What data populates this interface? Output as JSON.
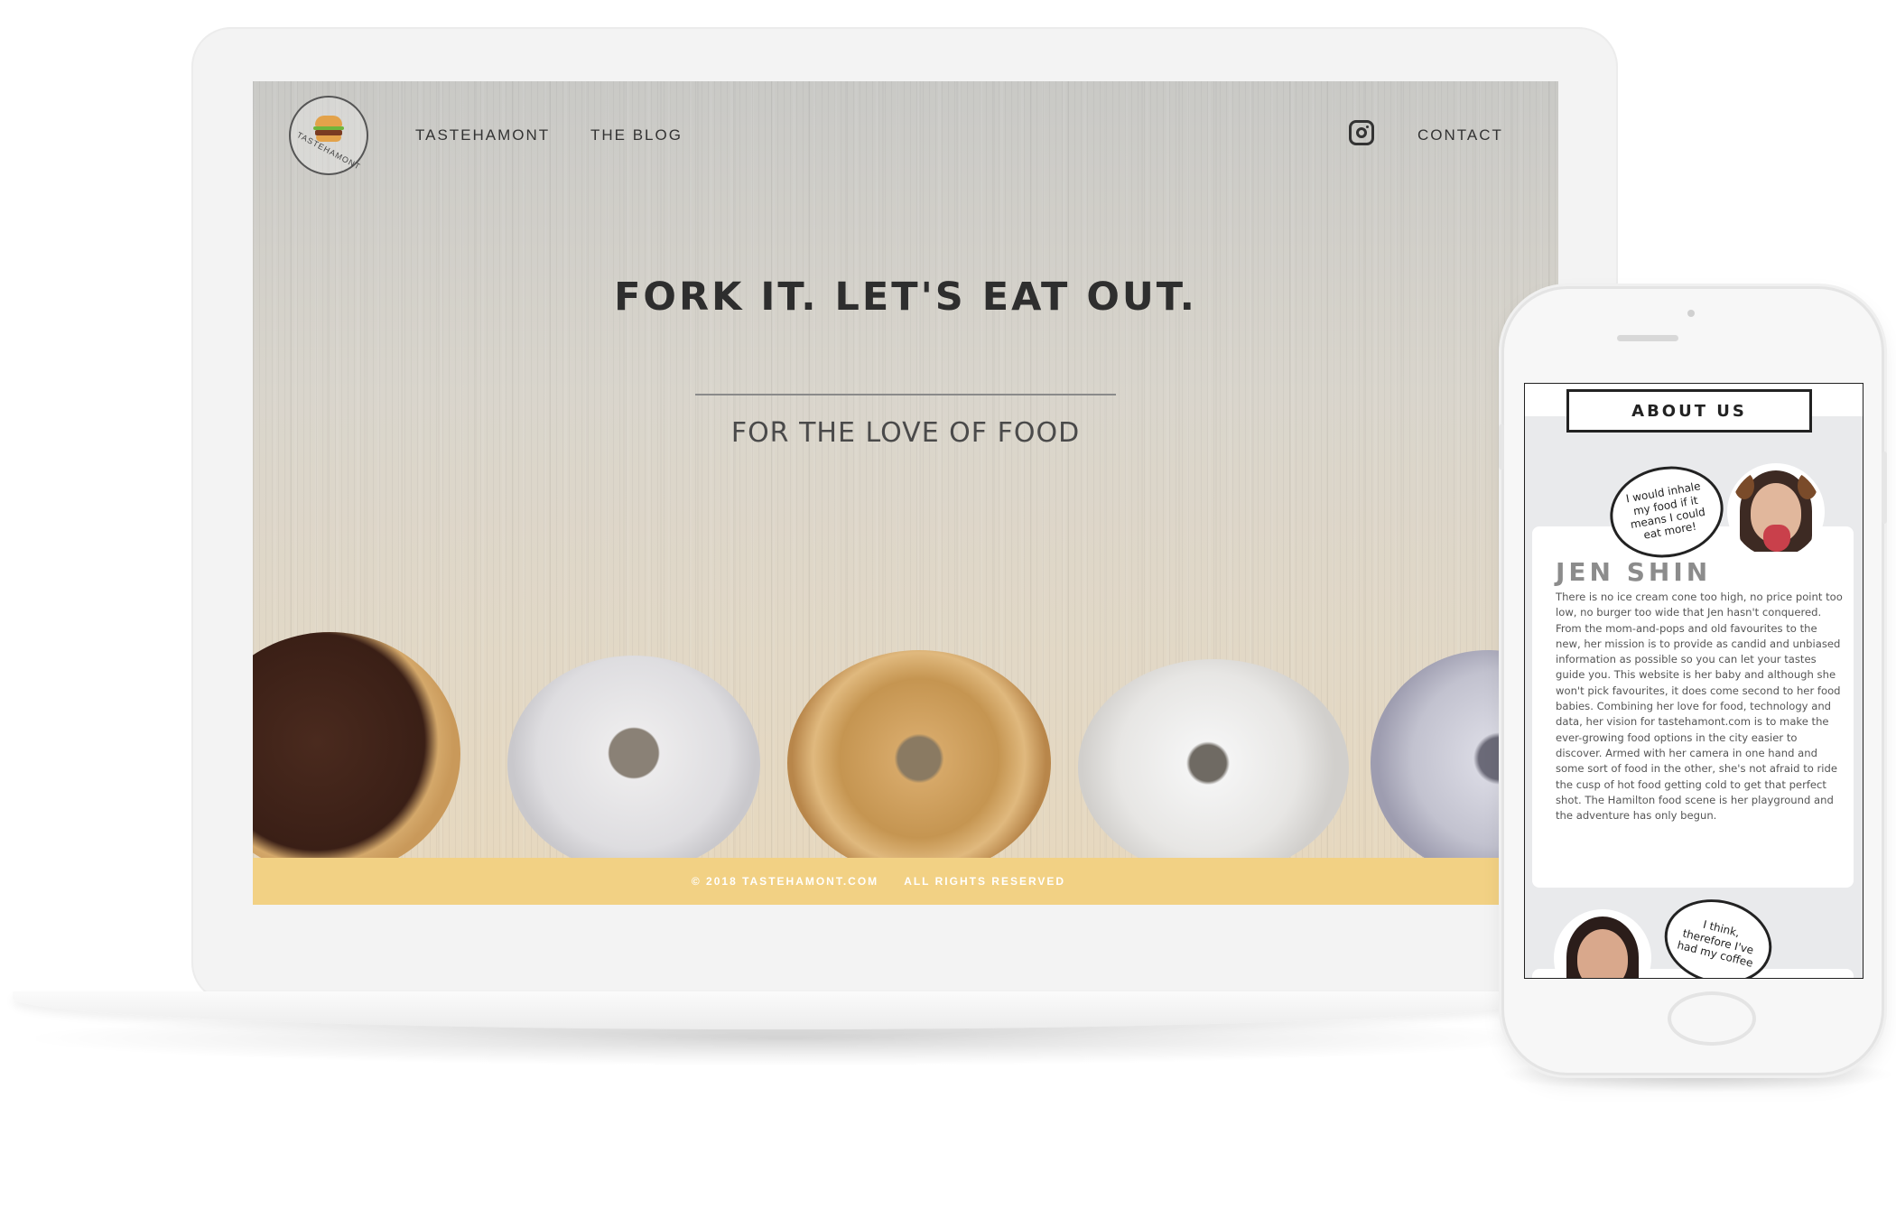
{
  "site": {
    "logo_text": "TASTEHAMONT",
    "nav": {
      "brand": "TASTEHAMONT",
      "blog": "THE BLOG",
      "contact": "CONTACT"
    },
    "hero": {
      "title": "FORK IT. LET'S EAT OUT.",
      "subtitle": "FOR THE LOVE OF FOOD"
    },
    "footer": {
      "copyright": "© 2018 TASTEHAMONT.COM",
      "rights": "ALL RIGHTS RESERVED"
    },
    "icons": {
      "logo": "burger-logo-icon",
      "social": "instagram-icon"
    }
  },
  "mobile": {
    "about_button": "ABOUT US",
    "profile": {
      "name": "JEN SHIN",
      "quote": "I would inhale my food if it means I could eat more!",
      "bio": "There is no ice cream cone too high, no price point too low, no burger too wide that Jen hasn't conquered. From the mom-and-pops and old favourites to the new, her mission is to provide as candid and unbiased information as possible so you can let your tastes guide you. This website is her baby and although she won't pick favourites, it does come second to her food babies. Combining her love for food, technology and data, her vision for tastehamont.com is to make the ever-growing food options in the city easier to discover. Armed with her camera in one hand and some sort of food in the other, she's not afraid to ride the cusp of hot food getting cold to get that perfect shot. The Hamilton food scene is her playground and the adventure has only begun."
    },
    "second_profile": {
      "quote": "I think, therefore I've had my coffee"
    }
  },
  "colors": {
    "footer_bar": "#f2d184",
    "text_dark": "#2e2e2e",
    "name_gray": "#8c8c8c"
  }
}
